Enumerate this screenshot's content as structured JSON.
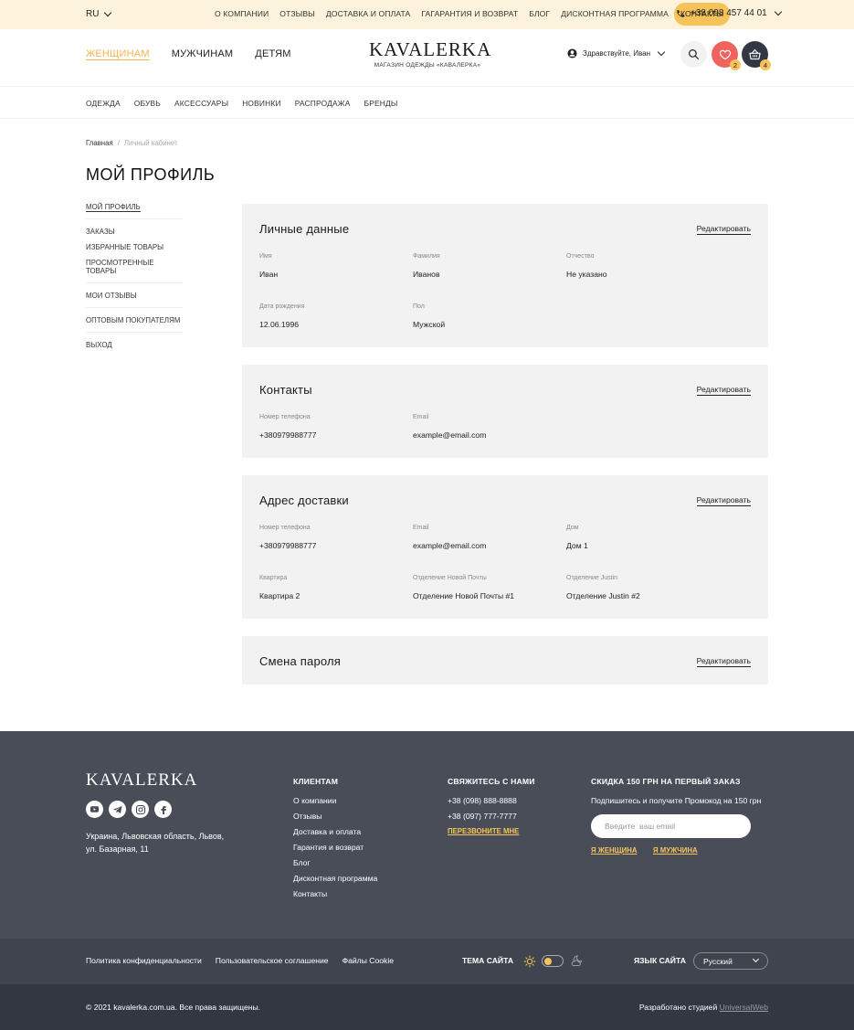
{
  "topbar": {
    "lang": "RU",
    "nav": [
      "О КОМПАНИИ",
      "ОТЗЫВЫ",
      "ДОСТАВКА И ОПЛАТА",
      "ГАГАРАНТИЯ И ВОЗВРАТ",
      "БЛОГ",
      "ДИСКОНТНАЯ ПРОГРАММА",
      "КОНТАКТЫ"
    ],
    "active_nav": "КОНТАКТЫ",
    "phone": "+38 098 457 44 01"
  },
  "header": {
    "gender": [
      "ЖЕНЩИНАМ",
      "МУЖЧИНАМ",
      "ДЕТЯМ"
    ],
    "logo": "KAVALERKA",
    "logo_sub": "МАГАЗИН ОДЕЖДЫ «КАВАЛЕРКА»",
    "greeting": "Здравствуйте, Иван",
    "fav_count": "2",
    "cart_count": "4"
  },
  "catnav": [
    "ОДЕЖДА",
    "ОБУВЬ",
    "АКСЕССУАРЫ",
    "НОВИНКИ",
    "РАСПРОДАЖА",
    "БРЕНДЫ"
  ],
  "breadcrumb": {
    "home": "Главная",
    "sep": "/",
    "current": "Личный кабинет"
  },
  "page_title": "МОЙ ПРОФИЛЬ",
  "sidebar": {
    "profile": "МОЙ ПРОФИЛЬ",
    "orders": "ЗАКАЗЫ",
    "favorites": "ИЗБРАННЫЕ ТОВАРЫ",
    "viewed": "ПРОСМОТРЕННЫЕ ТОВАРЫ",
    "reviews": "МОИ ОТЗЫВЫ",
    "wholesale": "ОПТОВЫМ ПОКУПАТЕЛЯМ",
    "logout": "ВЫХОД"
  },
  "edit_label": "Редактировать",
  "personal": {
    "title": "Личные данные",
    "fields": [
      {
        "label": "Имя",
        "value": "Иван"
      },
      {
        "label": "Фамилия",
        "value": "Иванов"
      },
      {
        "label": "Отчество",
        "value": "Не указано"
      },
      {
        "label": "Дата рождения",
        "value": "12.06.1996"
      },
      {
        "label": "Пол",
        "value": "Мужской"
      }
    ]
  },
  "contacts": {
    "title": "Контакты",
    "fields": [
      {
        "label": "Номер телефона",
        "value": "+380979988777"
      },
      {
        "label": "Email",
        "value": "example@email.com"
      }
    ]
  },
  "address": {
    "title": "Адрес доставки",
    "fields": [
      {
        "label": "Номер телефона",
        "value": "+380979988777"
      },
      {
        "label": "Email",
        "value": "example@email.com"
      },
      {
        "label": "Дом",
        "value": "Дом 1"
      },
      {
        "label": "Квартира",
        "value": "Квартира 2"
      },
      {
        "label": "Отделение Новой Почты",
        "value": "Отделение Новой Почты #1"
      },
      {
        "label": "Отделение Justin",
        "value": "Отделение Justin #2"
      }
    ]
  },
  "password": {
    "title": "Смена пароля"
  },
  "footer": {
    "logo": "KAVALERKA",
    "address_line1": "Украина, Львовская область, Львов,",
    "address_line2": "ул. Базарная, 11",
    "clients_title": "КЛИЕНТАМ",
    "clients_links": [
      "О компании",
      "Отзывы",
      "Доставка и оплата",
      "Гарантия и возврат",
      "Блог",
      "Дисконтная программа",
      "Контакты"
    ],
    "contact_title": "СВЯЖИТЕСЬ С НАМИ",
    "phone1": "+38 (098) 888-8888",
    "phone2": "+38 (097) 777-7777",
    "callback": "ПЕРЕЗВОНИТЕ МНЕ",
    "promo_title": "СКИДКА 150 ГРН НА ПЕРВЫЙ ЗАКАЗ",
    "promo_sub": "Подпишитесь и получите Промокод на 150 грн",
    "email_placeholder": "Введите  ваш email",
    "women_link": "Я ЖЕНЩИНА",
    "men_link": "Я МУЖЧИНА"
  },
  "footer2": {
    "privacy": "Политика конфиденциальности",
    "agreement": "Пользовательское соглашение",
    "cookies": "Файлы Cookie",
    "theme_label": "ТЕМА САЙТА",
    "lang_label": "ЯЗЫК САЙТА",
    "lang_value": "Русский"
  },
  "footer3": {
    "copyright": "© 2021 kavalerka.com.ua. Все права защищены.",
    "dev_prefix": "Разработано студией",
    "studio": "UniversalWeb"
  },
  "colors": {
    "accent": "#f6c35a",
    "fav": "#f0645f",
    "dark": "#333743",
    "footer": "#484d58"
  }
}
